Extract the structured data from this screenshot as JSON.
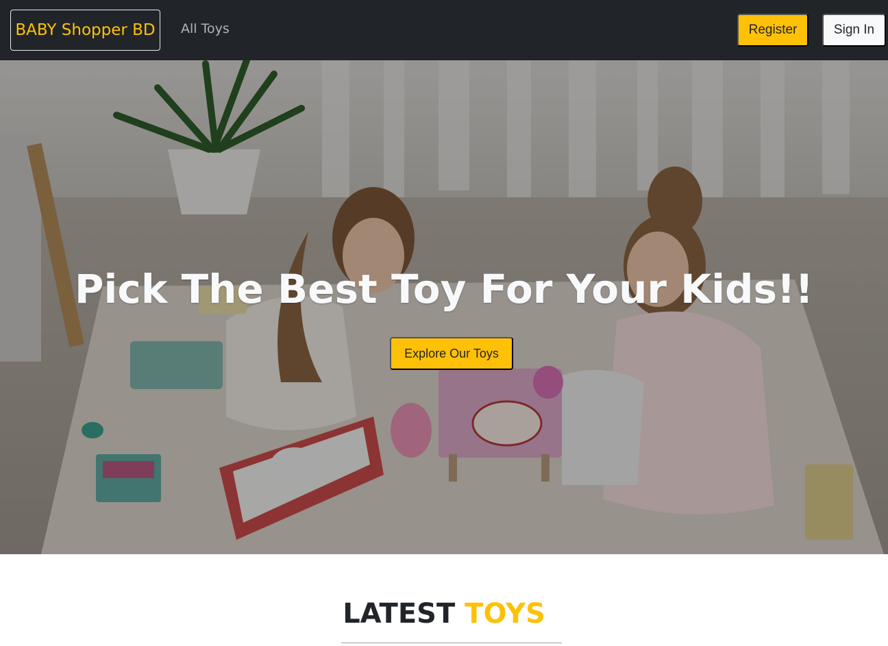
{
  "navbar": {
    "brand": "BABY Shopper BD",
    "links": [
      {
        "label": "All Toys"
      }
    ],
    "register_label": "Register",
    "signin_label": "Sign In"
  },
  "hero": {
    "title": "Pick The Best Toy For Your Kids!!",
    "cta_label": "Explore Our Toys"
  },
  "latest_section": {
    "heading_part1": "LATEST",
    "heading_part2": "TOYS"
  },
  "colors": {
    "navbar_bg": "#212529",
    "accent": "#ffc107",
    "light_button": "#f8f9fa",
    "nav_link": "#adb5bd"
  }
}
